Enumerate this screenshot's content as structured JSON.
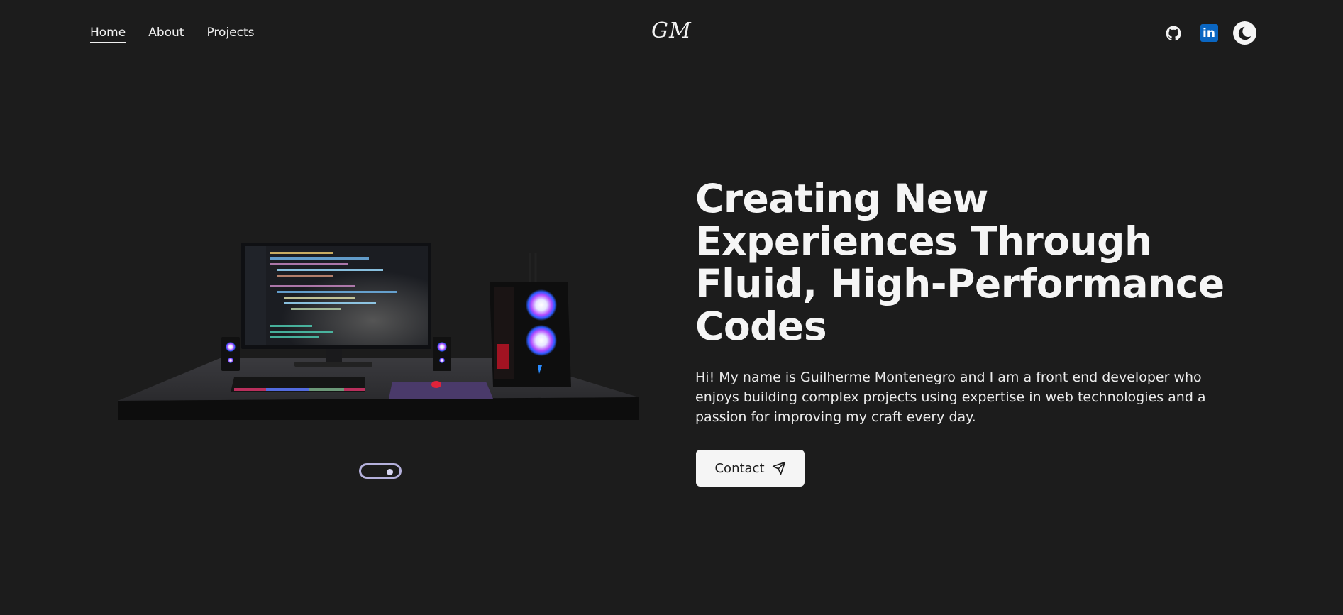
{
  "nav": {
    "items": [
      {
        "label": "Home",
        "active": true
      },
      {
        "label": "About",
        "active": false
      },
      {
        "label": "Projects",
        "active": false
      }
    ]
  },
  "logo": {
    "text": "GM"
  },
  "social": {
    "icons": [
      "github-icon",
      "linkedin-icon",
      "moon-icon"
    ],
    "linkedin_label": "in",
    "linkedin_color": "#0a66c2"
  },
  "hero": {
    "headline": "Creating New Experiences Through Fluid, High-Performance Codes",
    "intro": "Hi! My name is Guilherme Montenegro and I am a front end developer who enjoys building complex projects using expertise in web technologies and a passion for improving my craft every day.",
    "contact_label": "Contact",
    "contact_icon": "send-icon"
  },
  "colors": {
    "background": "#1c1c1c",
    "text": "#f5f5f5",
    "button_bg": "#f5f5f5",
    "scroll_indicator": "#b5b1dc"
  }
}
